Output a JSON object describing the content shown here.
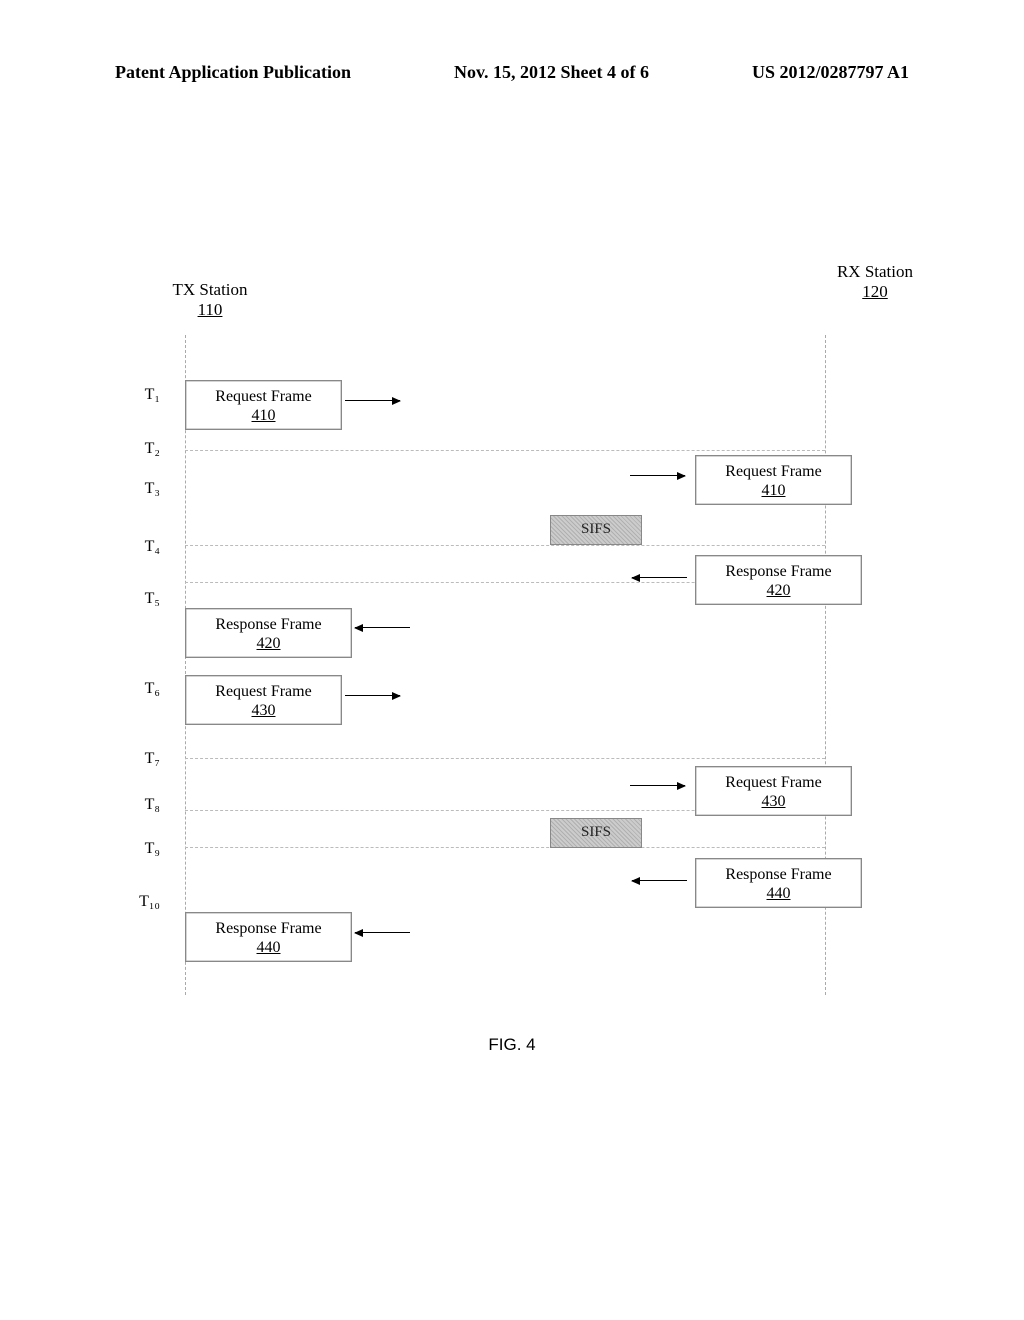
{
  "header": {
    "left": "Patent Application Publication",
    "center": "Nov. 15, 2012  Sheet 4 of 6",
    "right": "US 2012/0287797 A1"
  },
  "stations": {
    "tx": {
      "name": "TX Station",
      "ref": "110"
    },
    "rx": {
      "name": "RX Station",
      "ref": "120"
    }
  },
  "frames": {
    "req_410": {
      "label": "Request Frame",
      "ref": "410"
    },
    "resp_420": {
      "label": "Response Frame",
      "ref": "420"
    },
    "req_430": {
      "label": "Request Frame",
      "ref": "430"
    },
    "resp_440": {
      "label": "Response Frame",
      "ref": "440"
    }
  },
  "sifs": "SIFS",
  "time_labels": [
    "T₁",
    "T₂",
    "T₃",
    "T₄",
    "T₅",
    "T₆",
    "T₇",
    "T₈",
    "T₉",
    "T₁₀"
  ],
  "caption": "FIG. 4"
}
